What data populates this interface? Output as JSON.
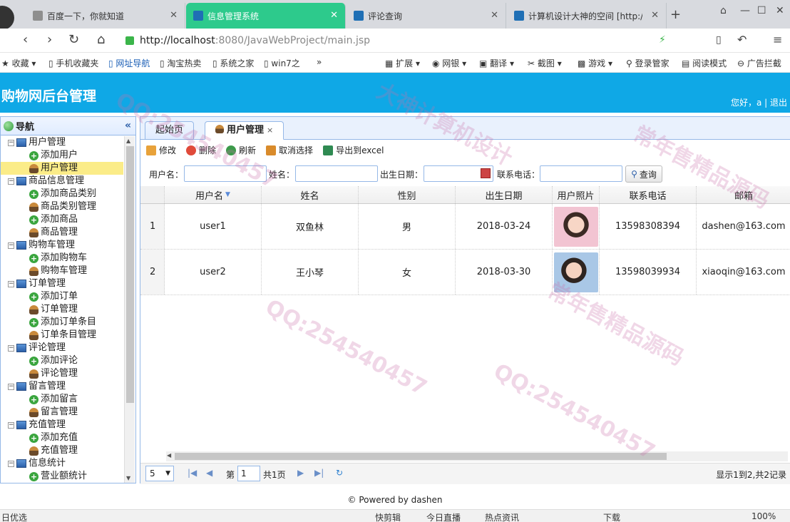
{
  "browser": {
    "tabs": [
      {
        "label": "百度一下，你就知道"
      },
      {
        "label": "信息管理系统"
      },
      {
        "label": "评论查询"
      },
      {
        "label": "计算机设计大神的空间 [http://"
      }
    ],
    "new_tab": "+",
    "url_host": "http://localhost",
    "url_rest": ":8080/JavaWebProject/main.jsp",
    "bookmarks": [
      "收藏",
      "手机收藏夹",
      "网址导航",
      "淘宝热卖",
      "系统之家",
      "win7之",
      "»"
    ],
    "toolbar_items": [
      "扩展",
      "网银",
      "翻译",
      "截图",
      "游戏",
      "登录管家",
      "阅读模式",
      "广告拦截"
    ]
  },
  "app": {
    "title": "购物网后台管理",
    "greeting": "您好，a",
    "logout": "退出",
    "footer": "© Powered by dashen"
  },
  "sidebar": {
    "title": "导航",
    "collapse_icon": "«",
    "tree": [
      {
        "type": "group",
        "label": "用户管理"
      },
      {
        "type": "add",
        "label": "添加用户"
      },
      {
        "type": "manage",
        "label": "用户管理",
        "selected": true
      },
      {
        "type": "group",
        "label": "商品信息管理"
      },
      {
        "type": "add",
        "label": "添加商品类别"
      },
      {
        "type": "manage",
        "label": "商品类别管理"
      },
      {
        "type": "add",
        "label": "添加商品"
      },
      {
        "type": "manage",
        "label": "商品管理"
      },
      {
        "type": "group",
        "label": "购物车管理"
      },
      {
        "type": "add",
        "label": "添加购物车"
      },
      {
        "type": "manage",
        "label": "购物车管理"
      },
      {
        "type": "group",
        "label": "订单管理"
      },
      {
        "type": "add",
        "label": "添加订单"
      },
      {
        "type": "manage",
        "label": "订单管理"
      },
      {
        "type": "add",
        "label": "添加订单条目"
      },
      {
        "type": "manage",
        "label": "订单条目管理"
      },
      {
        "type": "group",
        "label": "评论管理"
      },
      {
        "type": "add",
        "label": "添加评论"
      },
      {
        "type": "manage",
        "label": "评论管理"
      },
      {
        "type": "group",
        "label": "留言管理"
      },
      {
        "type": "add",
        "label": "添加留言"
      },
      {
        "type": "manage",
        "label": "留言管理"
      },
      {
        "type": "group",
        "label": "充值管理"
      },
      {
        "type": "add",
        "label": "添加充值"
      },
      {
        "type": "manage",
        "label": "充值管理"
      },
      {
        "type": "group",
        "label": "信息统计"
      },
      {
        "type": "add",
        "label": "营业额统计"
      }
    ]
  },
  "main": {
    "tabs": [
      {
        "label": "起始页"
      },
      {
        "label": "用户管理",
        "close": "×"
      }
    ],
    "toolbar": {
      "edit": "修改",
      "delete": "删除",
      "refresh": "刷新",
      "cancel_select": "取消选择",
      "export": "导出到excel"
    },
    "search": {
      "username_label": "用户名：",
      "name_label": "姓名：",
      "birth_label": "出生日期：",
      "phone_label": "联系电话：",
      "button": "查询"
    },
    "grid": {
      "columns": [
        "用户名",
        "姓名",
        "性别",
        "出生日期",
        "用户照片",
        "联系电话",
        "邮箱"
      ],
      "sort_icon": "▼",
      "rows": [
        {
          "idx": "1",
          "username": "user1",
          "name": "双鱼林",
          "gender": "男",
          "birth": "2018-03-24",
          "phone": "13598308394",
          "email": "dashen@163.com"
        },
        {
          "idx": "2",
          "username": "user2",
          "name": "王小琴",
          "gender": "女",
          "birth": "2018-03-30",
          "phone": "13598039934",
          "email": "xiaoqin@163.com"
        }
      ]
    },
    "pager": {
      "page_size": "5",
      "page_prefix": "第",
      "page_value": "1",
      "page_total": "共1页",
      "summary": "显示1到2,共2记录"
    }
  },
  "status_bar": [
    "日优选",
    "快剪辑",
    "今日直播",
    "热点资讯",
    "下载",
    "100%"
  ],
  "watermarks": [
    "常年售精品源码",
    "QQ:254540457",
    "大神计算机设计"
  ],
  "colors": {
    "header": "#0fa8e6",
    "active_tab": "#2dca8c",
    "border": "#95b8e7",
    "selected_row": "#fbec88"
  }
}
